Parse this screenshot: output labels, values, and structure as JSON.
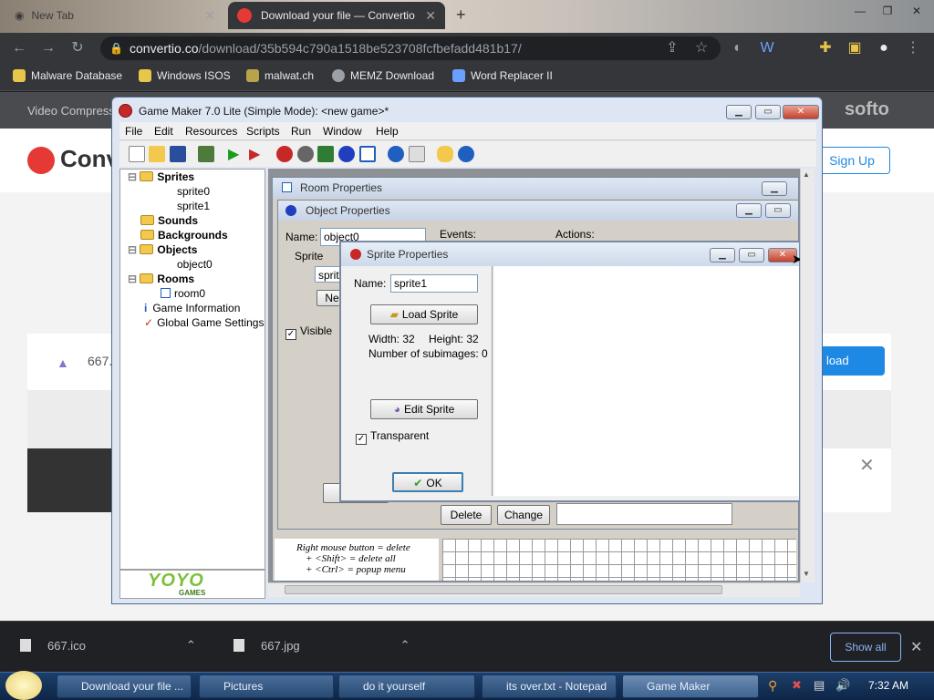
{
  "browser": {
    "tabs": [
      {
        "label": "New Tab",
        "active": false
      },
      {
        "label": "Download your file — Convertio",
        "active": true
      }
    ],
    "url": {
      "host": "convertio.co",
      "path": "/download/35b594c790a1518be523708fcfbefadd481b17/"
    },
    "bookmarks": [
      "Malware Database",
      "Windows ISOS",
      "malwat.ch",
      "MEMZ Download",
      "Word Replacer II"
    ]
  },
  "site": {
    "nav_left": "Video Compress",
    "brand_right": "softo",
    "logo_text": "Conv",
    "sign_up": "Sign Up",
    "file_size_fragment": "667.",
    "download_fragment": "load"
  },
  "gamemaker": {
    "title": "Game Maker 7.0 Lite (Simple Mode): <new game>*",
    "menu": [
      "File",
      "Edit",
      "Resources",
      "Scripts",
      "Run",
      "Window",
      "Help"
    ],
    "tree": {
      "sprites": "Sprites",
      "sprite0": "sprite0",
      "sprite1": "sprite1",
      "sounds": "Sounds",
      "backgrounds": "Backgrounds",
      "objects": "Objects",
      "object0": "object0",
      "rooms": "Rooms",
      "room0": "room0",
      "game_info": "Game Information",
      "global_settings": "Global Game Settings"
    },
    "logo": "YOYO",
    "logo_sub": "GAMES",
    "room_properties": {
      "title": "Room Properties"
    },
    "room_hints": [
      "Right mouse button = delete",
      "+ <Shift> = delete all",
      "+ <Ctrl> = popup menu"
    ],
    "object_properties": {
      "title": "Object Properties",
      "name_label": "Name:",
      "name_value": "object0",
      "sprite_label": "Sprite",
      "sprite_value": "sprite",
      "new_label": "Ne",
      "visible_label": "Visible",
      "events_label": "Events:",
      "actions_label": "Actions:",
      "delete_label": "Delete",
      "change_label": "Change"
    },
    "sprite_properties": {
      "title": "Sprite Properties",
      "name_label": "Name:",
      "name_value": "sprite1",
      "load_sprite": "Load Sprite",
      "width_text": "Width: 32",
      "height_text": "Height: 32",
      "subimages_text": "Number of subimages: 0",
      "edit_sprite": "Edit Sprite",
      "transparent_label": "Transparent",
      "ok_label": "OK"
    }
  },
  "downloads": [
    {
      "name": "667.ico"
    },
    {
      "name": "667.jpg"
    }
  ],
  "show_all": "Show all",
  "taskbar": {
    "items": [
      {
        "label": "Download your file ...",
        "active": false
      },
      {
        "label": "Pictures",
        "active": false
      },
      {
        "label": "do it yourself",
        "active": false
      },
      {
        "label": "its over.txt - Notepad",
        "active": false
      },
      {
        "label": "Game Maker",
        "active": true
      }
    ],
    "clock": "7:32 AM"
  },
  "colors": {
    "accent_blue": "#8ab4f8",
    "convertio_red": "#e53935",
    "sign_up_blue": "#1e88e5"
  }
}
